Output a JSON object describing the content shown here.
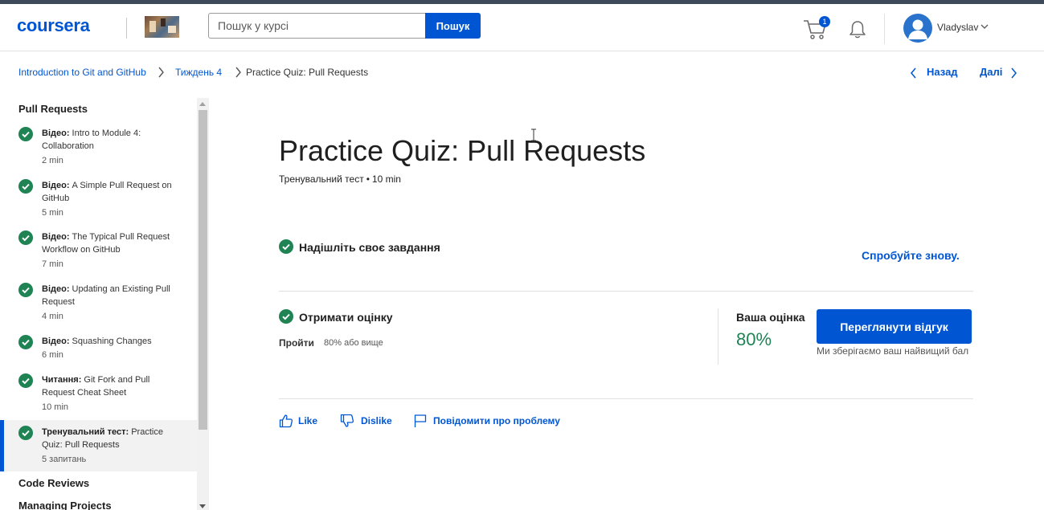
{
  "header": {
    "logo": "coursera",
    "search_placeholder": "Пошук у курсі",
    "search_button": "Пошук",
    "cart_count": "1",
    "user_name": "Vladyslav"
  },
  "breadcrumb": {
    "course": "Introduction to Git and GitHub",
    "week": "Тиждень 4",
    "current": "Practice Quiz: Pull Requests",
    "prev": "Назад",
    "next": "Далі"
  },
  "sidebar": {
    "section": "Pull Requests",
    "items": [
      {
        "type": "Відео:",
        "title": " Intro to Module 4: Collaboration",
        "duration": "2 min"
      },
      {
        "type": "Відео:",
        "title": " A Simple Pull Request on GitHub",
        "duration": "5 min"
      },
      {
        "type": "Відео:",
        "title": " The Typical Pull Request Workflow on GitHub",
        "duration": "7 min"
      },
      {
        "type": "Відео:",
        "title": " Updating an Existing Pull Request",
        "duration": "4 min"
      },
      {
        "type": "Відео:",
        "title": " Squashing Changes",
        "duration": "6 min"
      },
      {
        "type": "Читання:",
        "title": " Git Fork and Pull Request Cheat Sheet",
        "duration": "10 min"
      },
      {
        "type": "Тренувальний тест:",
        "title": " Practice Quiz: Pull Requests",
        "duration": "5 запитань"
      }
    ],
    "next_sections": [
      "Code Reviews",
      "Managing Projects"
    ]
  },
  "main": {
    "title": "Practice Quiz: Pull Requests",
    "subtitle_type": "Тренувальний тест",
    "subtitle_time": "10 min",
    "submit_label": "Надішліть своє завдання",
    "retry_label": "Спробуйте знову.",
    "grade_step_label": "Отримати оцінку",
    "pass_label": "Пройти",
    "pass_value": "80% або вище",
    "your_grade_label": "Ваша оцінка",
    "your_grade_value": "80%",
    "feedback_button": "Переглянути відгук",
    "grade_note": "Ми зберігаємо ваш найвищий бал",
    "like": "Like",
    "dislike": "Dislike",
    "report": "Повідомити про проблему"
  },
  "colors": {
    "brand_blue": "#0056d2",
    "success_green": "#1f8354"
  }
}
